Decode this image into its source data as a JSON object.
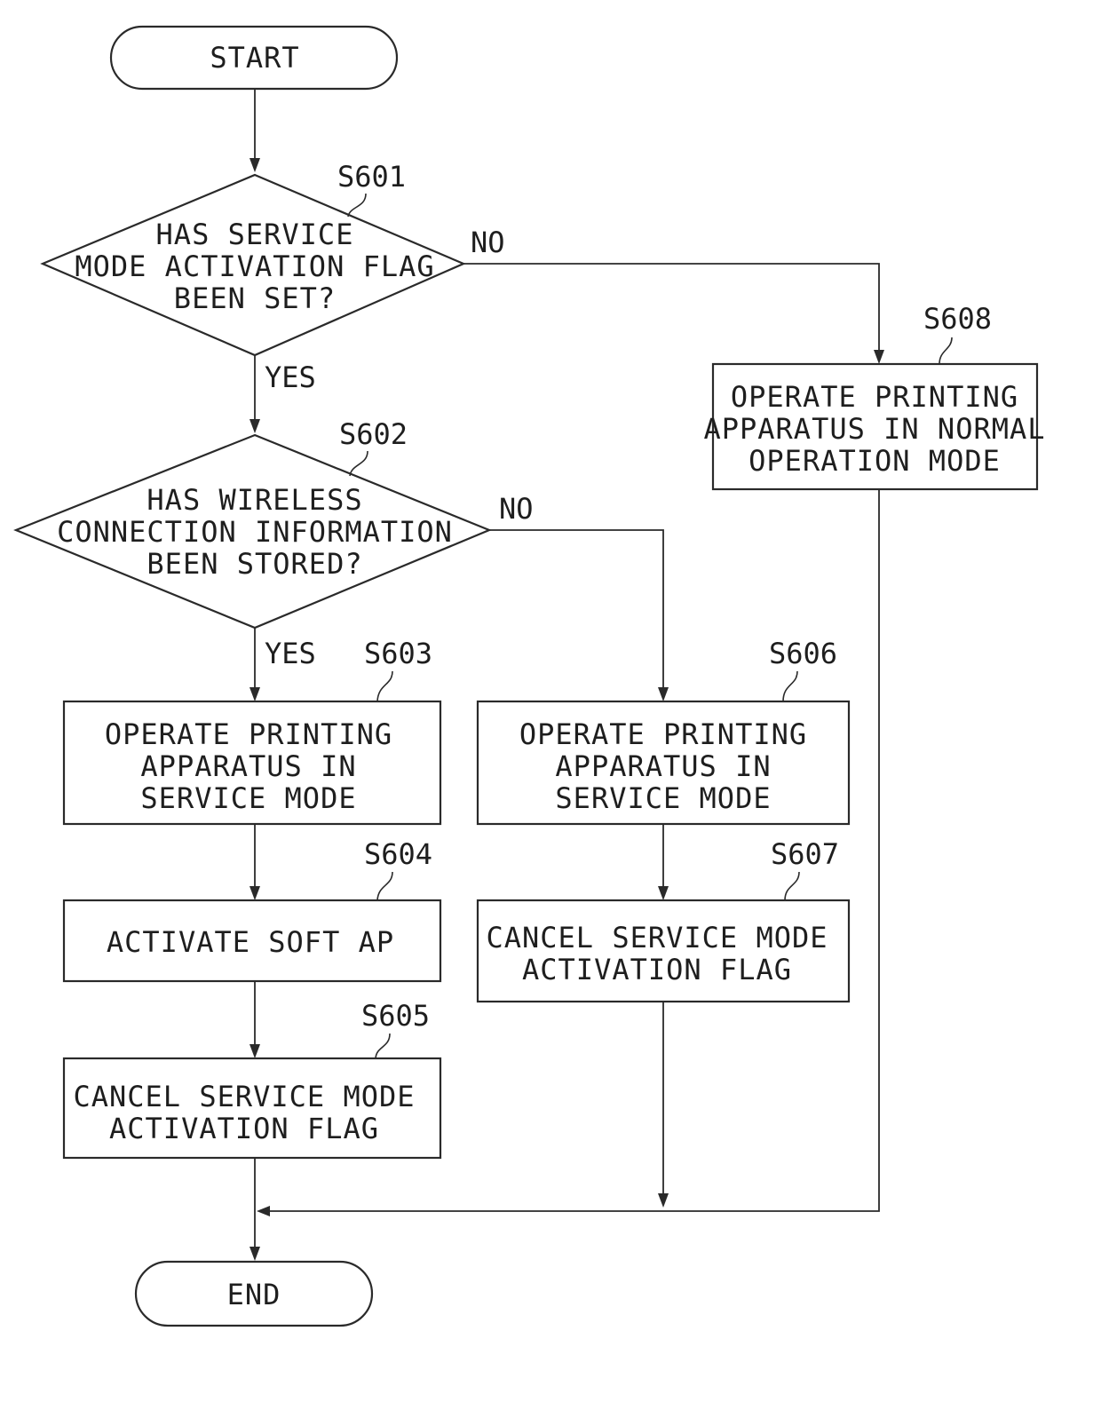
{
  "diagram": {
    "type": "flowchart",
    "terminals": {
      "start": "START",
      "end": "END"
    },
    "decisions": [
      {
        "id": "S601",
        "lines": [
          "HAS SERVICE",
          "MODE ACTIVATION FLAG",
          "BEEN SET?"
        ],
        "yes_label": "YES",
        "no_label": "NO"
      },
      {
        "id": "S602",
        "lines": [
          "HAS WIRELESS",
          "CONNECTION INFORMATION",
          "BEEN STORED?"
        ],
        "yes_label": "YES",
        "no_label": "NO"
      }
    ],
    "processes": [
      {
        "id": "S603",
        "lines": [
          "OPERATE PRINTING",
          "APPARATUS IN",
          "SERVICE MODE"
        ]
      },
      {
        "id": "S604",
        "lines": [
          "ACTIVATE SOFT AP"
        ]
      },
      {
        "id": "S605",
        "lines": [
          "CANCEL SERVICE MODE",
          "ACTIVATION FLAG"
        ]
      },
      {
        "id": "S606",
        "lines": [
          "OPERATE PRINTING",
          "APPARATUS IN",
          "SERVICE MODE"
        ]
      },
      {
        "id": "S607",
        "lines": [
          "CANCEL SERVICE MODE",
          "ACTIVATION FLAG"
        ]
      },
      {
        "id": "S608",
        "lines": [
          "OPERATE PRINTING",
          "APPARATUS IN NORMAL",
          "OPERATION MODE"
        ]
      }
    ],
    "edges": [
      {
        "from": "START",
        "to": "S601"
      },
      {
        "from": "S601",
        "to": "S602",
        "label": "YES"
      },
      {
        "from": "S601",
        "to": "S608",
        "label": "NO"
      },
      {
        "from": "S602",
        "to": "S603",
        "label": "YES"
      },
      {
        "from": "S602",
        "to": "S606",
        "label": "NO"
      },
      {
        "from": "S603",
        "to": "S604"
      },
      {
        "from": "S604",
        "to": "S605"
      },
      {
        "from": "S605",
        "to": "END"
      },
      {
        "from": "S606",
        "to": "S607"
      },
      {
        "from": "S607",
        "to": "END"
      },
      {
        "from": "S608",
        "to": "END"
      }
    ]
  }
}
